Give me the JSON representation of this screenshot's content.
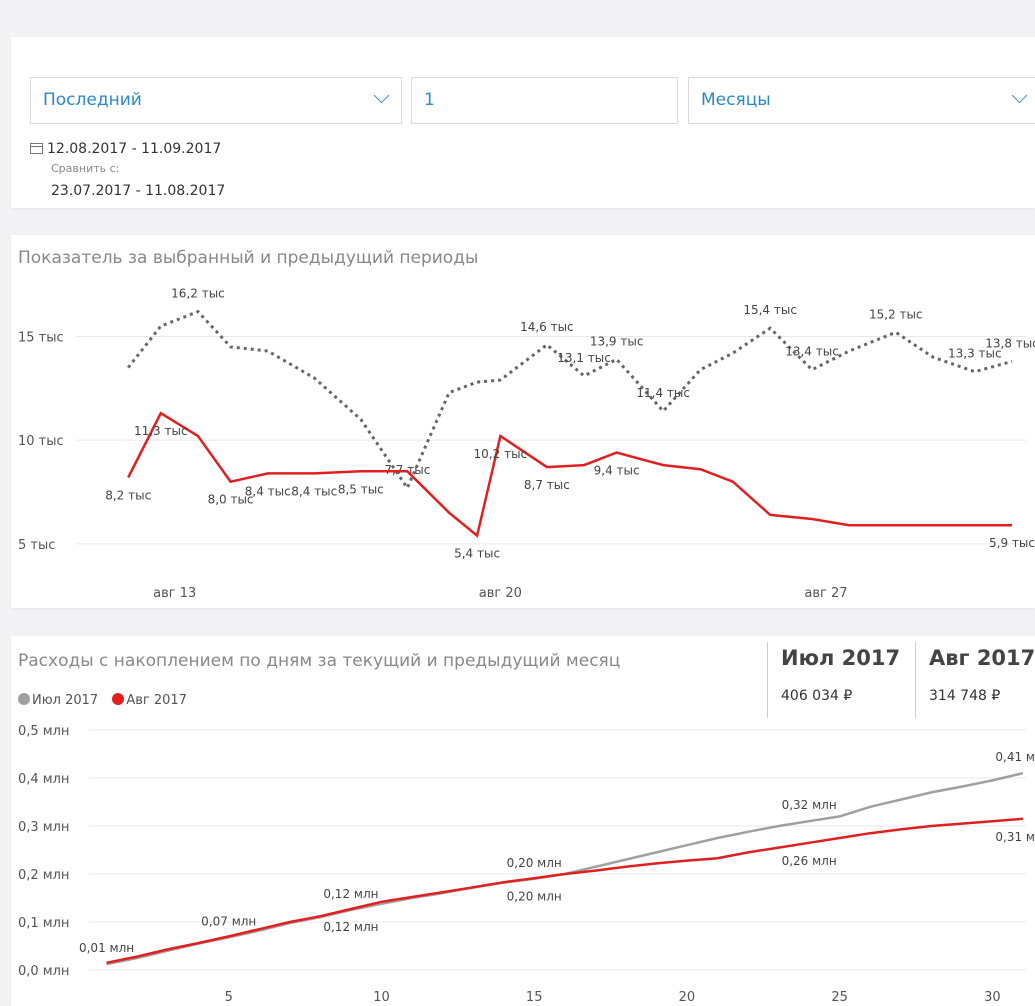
{
  "filters": {
    "period_value": "Последний",
    "count_value": "1",
    "unit_value": "Месяцы",
    "date_range": "12.08.2017 - 11.09.2017",
    "compare_label": "Сравнить с:",
    "compare_range": "23.07.2017 - 11.08.2017"
  },
  "chart1": {
    "title": "Показатель за выбранный и предыдущий периоды"
  },
  "chart2": {
    "title": "Расходы с накоплением по дням за текущий и предыдущий месяц",
    "kpi_jul_title": "Июл 2017",
    "kpi_jul_value": "406 034 ₽",
    "kpi_aug_title": "Авг 2017",
    "kpi_aug_value": "314 748 ₽"
  },
  "colors": {
    "accent": "#2a8ac9",
    "current": "#e02020",
    "previous": "#666666",
    "prev_cumulative": "#a0a0a0"
  },
  "chart_data": [
    {
      "type": "line",
      "title": "Показатель за выбранный и предыдущий периоды",
      "ylim": [
        3.5,
        17
      ],
      "y_ticks": [
        5,
        10,
        15
      ],
      "y_tick_labels": [
        "5 тыс",
        "10 тыс",
        "15 тыс"
      ],
      "x_ticks": [
        13,
        20,
        27
      ],
      "x_tick_labels": [
        "авг 13",
        "авг 20",
        "авг 27"
      ],
      "xlim": [
        11.2,
        31.3
      ],
      "grid": true,
      "series": [
        {
          "x": [
            12,
            12.7,
            13.5,
            14.2,
            15,
            16,
            17,
            18,
            18.9,
            19.5,
            20,
            21,
            21.8,
            22.5,
            23.5,
            24.3,
            25,
            25.8,
            26.7,
            27.5,
            28.5,
            29.3,
            30.2,
            31
          ],
          "values": [
            13.5,
            15.5,
            16.2,
            14.5,
            14.3,
            13,
            11,
            7.7,
            12.3,
            12.8,
            12.9,
            14.6,
            13.1,
            13.9,
            11.4,
            13.4,
            14.2,
            15.4,
            13.4,
            14.3,
            15.2,
            14,
            13.3,
            13.8
          ],
          "labels": [
            {
              "x": 13.5,
              "value": 16.2,
              "text": "16,2 тыс"
            },
            {
              "x": 18,
              "value": 7.7,
              "text": "7,7 тыс"
            },
            {
              "x": 21,
              "value": 14.6,
              "text": "14,6 тыс"
            },
            {
              "x": 21.8,
              "value": 13.1,
              "text": "13,1 тыс"
            },
            {
              "x": 22.5,
              "value": 13.9,
              "text": "13,9 тыс"
            },
            {
              "x": 23.5,
              "value": 11.4,
              "text": "11,4 тыс"
            },
            {
              "x": 25.8,
              "value": 15.4,
              "text": "15,4 тыс"
            },
            {
              "x": 26.7,
              "value": 13.4,
              "text": "13,4 тыс"
            },
            {
              "x": 28.5,
              "value": 15.2,
              "text": "15,2 тыс"
            },
            {
              "x": 30.2,
              "value": 13.3,
              "text": "13,3 тыс"
            },
            {
              "x": 31,
              "value": 13.8,
              "text": "13,8 тыс"
            }
          ]
        },
        {
          "x": [
            12,
            12.7,
            13.5,
            14.2,
            15,
            16,
            17,
            18,
            18.9,
            19.5,
            20,
            21,
            21.8,
            22.5,
            23.5,
            24.3,
            25,
            25.8,
            26.7,
            27.5,
            28.5,
            29.3,
            30.2,
            31
          ],
          "values": [
            8.2,
            11.3,
            10.2,
            8.0,
            8.4,
            8.4,
            8.5,
            8.5,
            6.5,
            5.4,
            10.2,
            8.7,
            8.8,
            9.4,
            8.8,
            8.6,
            8.0,
            6.4,
            6.2,
            5.9,
            5.9,
            5.9,
            5.9,
            5.9
          ],
          "labels": [
            {
              "x": 12,
              "value": 8.2,
              "text": "8,2 тыс"
            },
            {
              "x": 12.7,
              "value": 11.3,
              "text": "11,3 тыс"
            },
            {
              "x": 14.2,
              "value": 8.0,
              "text": "8,0 тыс"
            },
            {
              "x": 15,
              "value": 8.4,
              "text": "8,4 тыс"
            },
            {
              "x": 16,
              "value": 8.4,
              "text": "8,4 тыс"
            },
            {
              "x": 17,
              "value": 8.5,
              "text": "8,5 тыс"
            },
            {
              "x": 19.5,
              "value": 5.4,
              "text": "5,4 тыс"
            },
            {
              "x": 20,
              "value": 10.2,
              "text": "10,2 тыс"
            },
            {
              "x": 21,
              "value": 8.7,
              "text": "8,7 тыс"
            },
            {
              "x": 22.5,
              "value": 9.4,
              "text": "9,4 тыс"
            },
            {
              "x": 31,
              "value": 5.9,
              "text": "5,9 тыс"
            }
          ]
        }
      ]
    },
    {
      "type": "line",
      "title": "Расходы с накоплением по дням за текущий и предыдущий месяц",
      "ylim": [
        0,
        0.5
      ],
      "y_ticks": [
        0,
        0.1,
        0.2,
        0.3,
        0.4,
        0.5
      ],
      "y_tick_labels": [
        "0,0 млн",
        "0,1 млн",
        "0,2 млн",
        "0,3 млн",
        "0,4 млн",
        "0,5 млн"
      ],
      "x_ticks": [
        5,
        10,
        15,
        20,
        25,
        30
      ],
      "x_tick_labels": [
        "5",
        "10",
        "15",
        "20",
        "25",
        "30"
      ],
      "xlim": [
        0,
        31.1
      ],
      "grid": true,
      "legend": [
        "Июл 2017",
        "Авг 2017"
      ],
      "series": [
        {
          "name": "Июл 2017",
          "x": [
            1,
            2,
            3,
            4,
            5,
            6,
            7,
            8,
            9,
            10,
            11,
            12,
            13,
            14,
            15,
            16,
            17,
            18,
            19,
            20,
            21,
            22,
            23,
            24,
            25,
            26,
            27,
            28,
            29,
            30,
            31
          ],
          "values": [
            0.012,
            0.025,
            0.04,
            0.055,
            0.068,
            0.082,
            0.098,
            0.11,
            0.125,
            0.138,
            0.15,
            0.16,
            0.172,
            0.182,
            0.19,
            0.2,
            0.215,
            0.23,
            0.245,
            0.26,
            0.275,
            0.288,
            0.3,
            0.31,
            0.32,
            0.34,
            0.355,
            0.37,
            0.382,
            0.395,
            0.41
          ],
          "labels": [
            {
              "x": 1,
              "value": 0.012,
              "text": "0,01 млн"
            },
            {
              "x": 5,
              "value": 0.068,
              "text": "0,07 млн"
            },
            {
              "x": 9,
              "value": 0.125,
              "text": "0,12 млн"
            },
            {
              "x": 15,
              "value": 0.19,
              "text": "0,20 млн"
            },
            {
              "x": 24,
              "value": 0.31,
              "text": "0,32 млн"
            },
            {
              "x": 31,
              "value": 0.41,
              "text": "0,41 млн"
            }
          ]
        },
        {
          "name": "Авг 2017",
          "x": [
            1,
            2,
            3,
            4,
            5,
            6,
            7,
            8,
            9,
            10,
            11,
            12,
            13,
            14,
            15,
            16,
            17,
            18,
            19,
            20,
            21,
            22,
            23,
            24,
            25,
            26,
            27,
            28,
            29,
            30,
            31
          ],
          "values": [
            0.015,
            0.028,
            0.043,
            0.056,
            0.07,
            0.085,
            0.1,
            0.112,
            0.127,
            0.142,
            0.152,
            0.162,
            0.172,
            0.183,
            0.191,
            0.2,
            0.207,
            0.215,
            0.222,
            0.228,
            0.233,
            0.245,
            0.255,
            0.265,
            0.275,
            0.285,
            0.293,
            0.3,
            0.305,
            0.31,
            0.315
          ],
          "labels": [
            {
              "x": 9,
              "value": 0.127,
              "text": "0,12 млн"
            },
            {
              "x": 15,
              "value": 0.191,
              "text": "0,20 млн"
            },
            {
              "x": 24,
              "value": 0.265,
              "text": "0,26 млн"
            },
            {
              "x": 31,
              "value": 0.315,
              "text": "0,31 млн"
            }
          ]
        }
      ]
    }
  ]
}
